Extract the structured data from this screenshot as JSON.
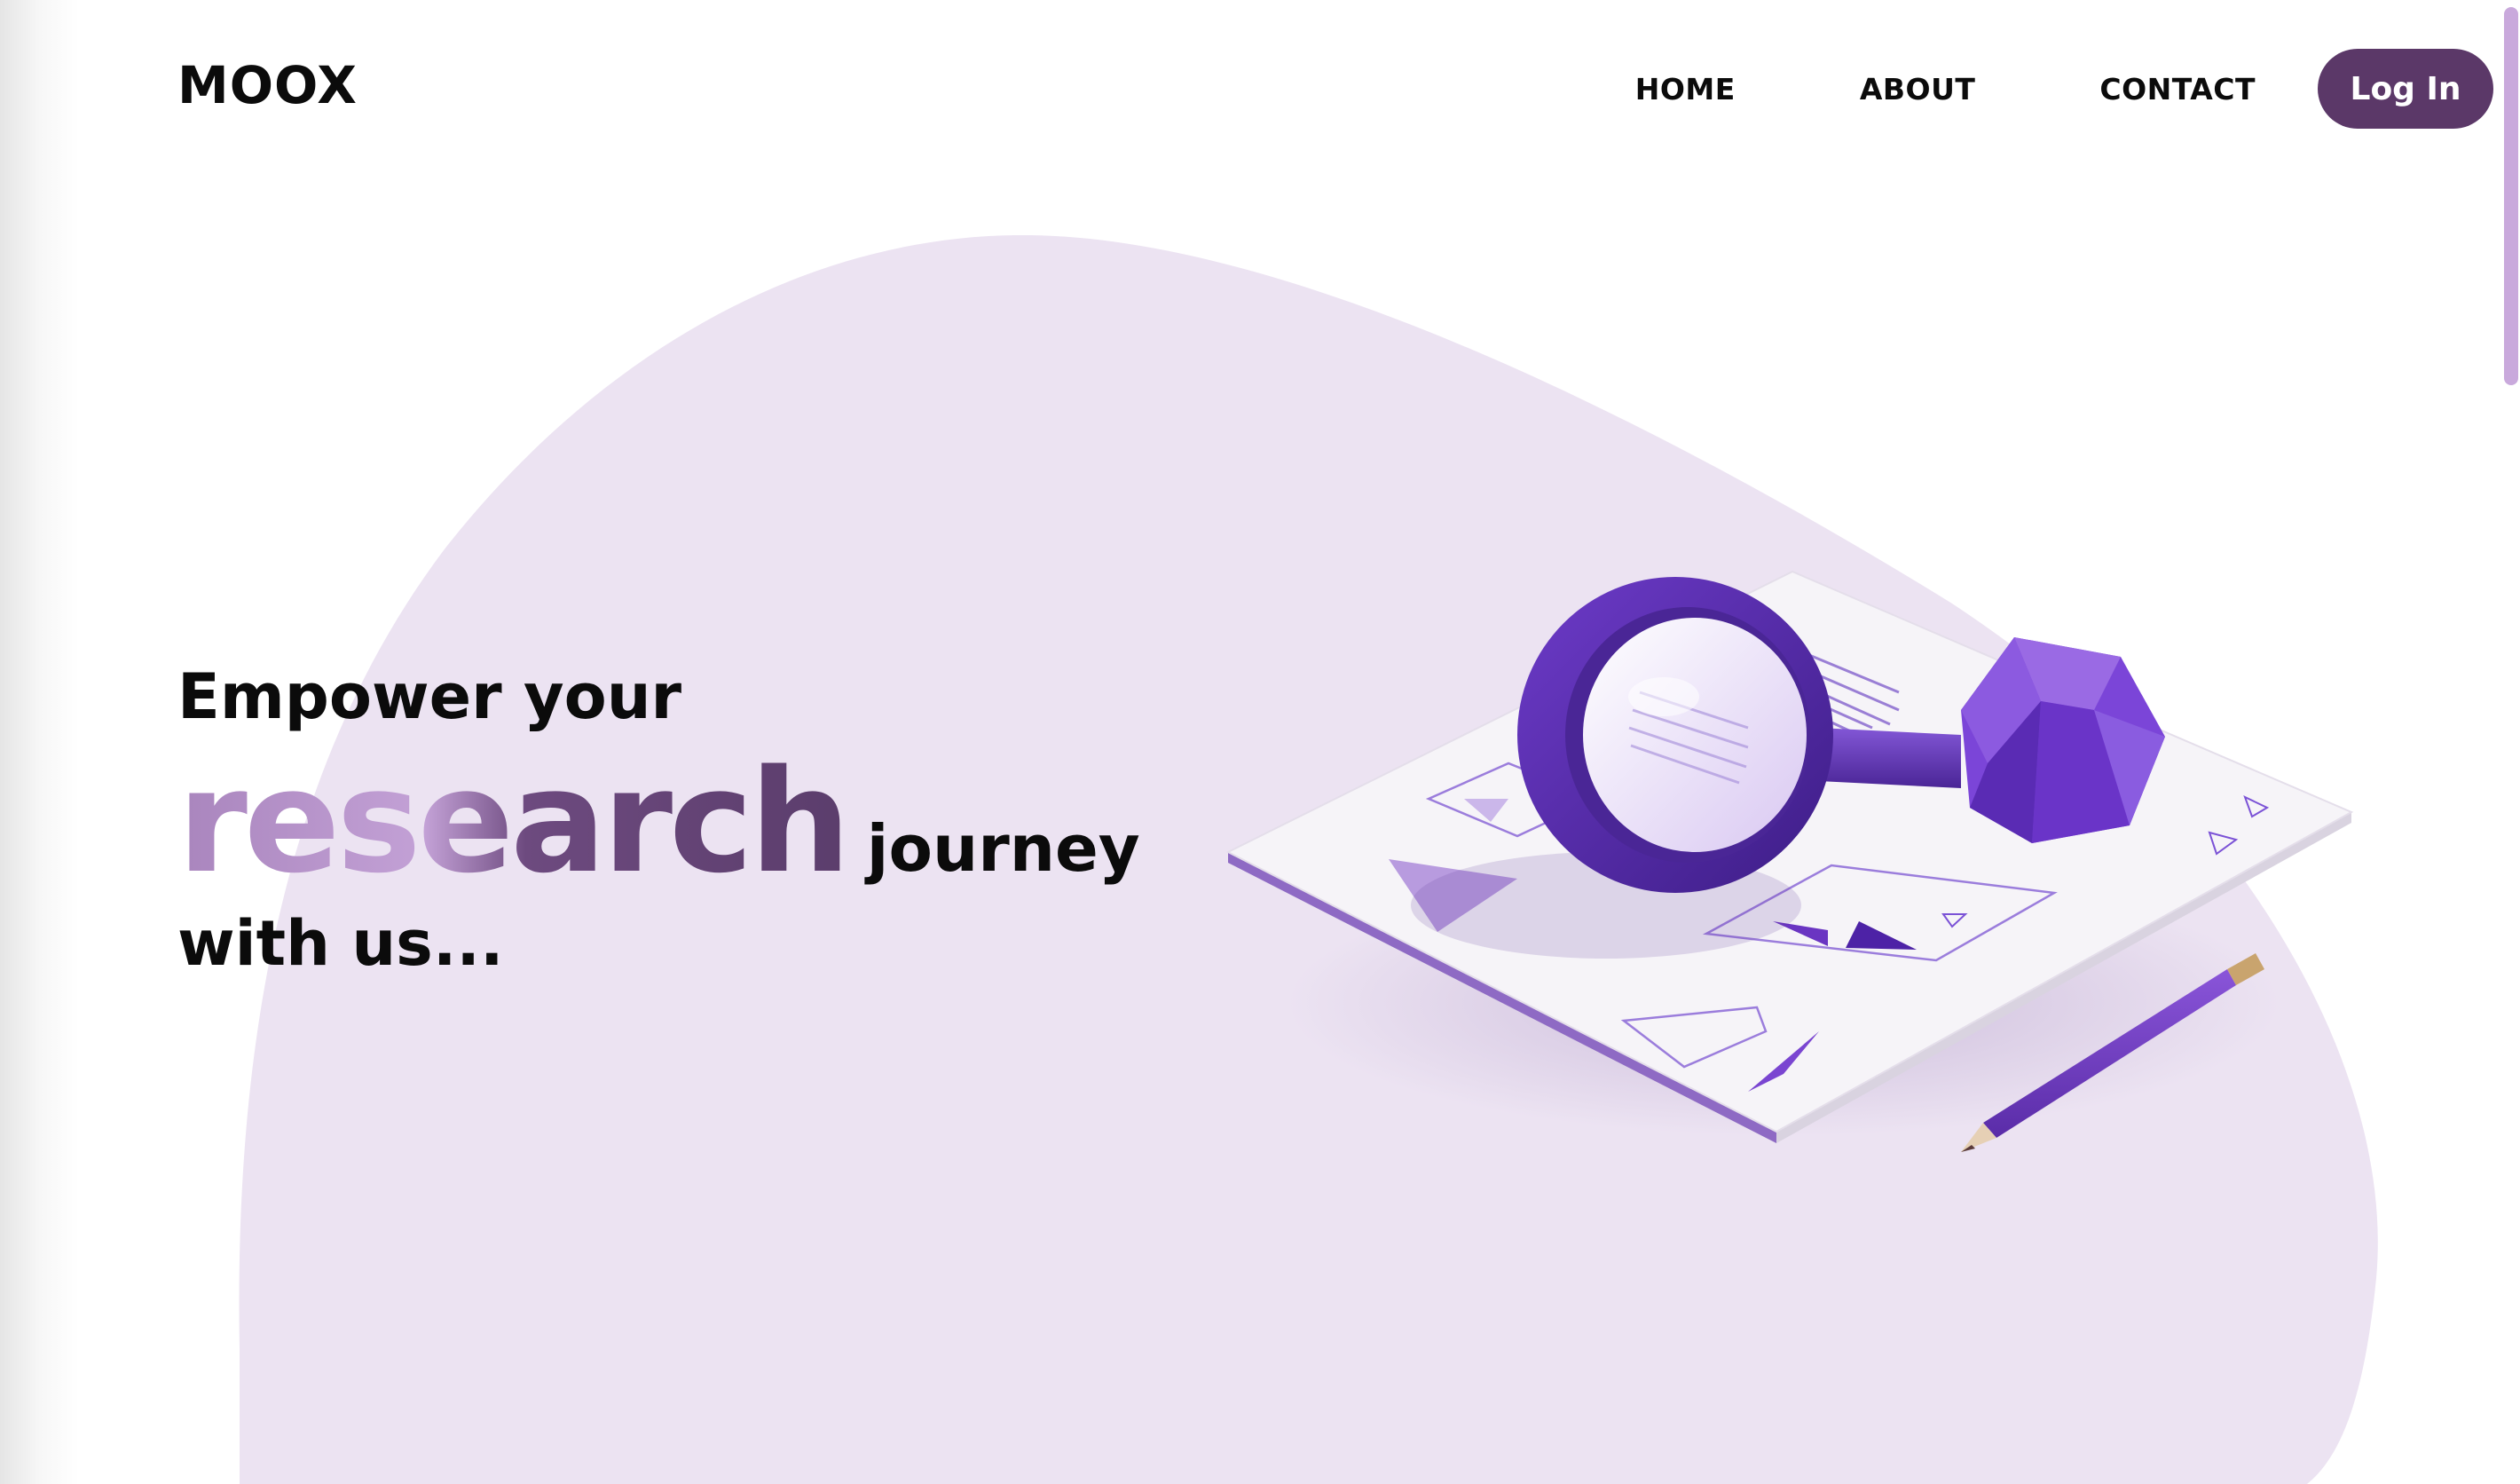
{
  "brand": {
    "logo_text": "MOOX"
  },
  "nav": {
    "items": [
      "HOME",
      "ABOUT",
      "CONTACT"
    ],
    "login_label": "Log In"
  },
  "hero": {
    "line1": "Empower your",
    "highlight": "research",
    "line2_tail": "journey",
    "line3": "with us..."
  },
  "illustration": {
    "icon": "magnifier-document-illustration"
  },
  "colors": {
    "accent": "#5b3868",
    "blob": "#ece3f2",
    "highlight_light": "#c3a1d6",
    "highlight_dark": "#5b3d6c",
    "illustration_purple": "#6a35c2"
  }
}
